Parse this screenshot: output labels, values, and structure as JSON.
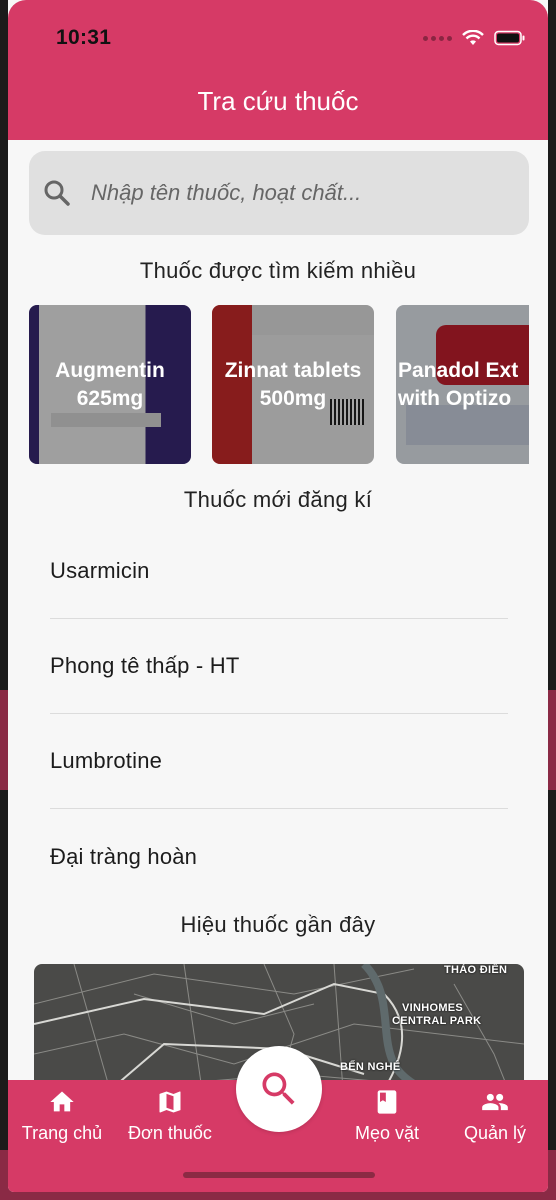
{
  "status_bar": {
    "time": "10:31"
  },
  "header": {
    "title": "Tra cứu thuốc"
  },
  "search": {
    "placeholder": "Nhập tên thuốc, hoạt chất..."
  },
  "popular": {
    "title": "Thuốc được tìm kiếm nhiều",
    "items": [
      {
        "line1": "Augmentin",
        "line2": "625mg"
      },
      {
        "line1": "Zinnat tablets",
        "line2": "500mg"
      },
      {
        "line1": "Panadol Ext",
        "line2": "with Optizo"
      }
    ]
  },
  "new_drugs": {
    "title": "Thuốc mới đăng kí",
    "items": [
      "Usarmicin",
      "Phong tê thấp - HT",
      "Lumbrotine",
      "Đại tràng hoàn"
    ]
  },
  "pharmacies": {
    "title": "Hiệu thuốc gần đây",
    "map_labels": [
      "THẢO ĐIỀN",
      "VINHOMES",
      "CENTRAL PARK",
      "BẾN NGHÉ"
    ]
  },
  "bottom_nav": {
    "items": [
      {
        "label": "Trang chủ",
        "icon": "home-icon"
      },
      {
        "label": "Đơn thuốc",
        "icon": "map-icon"
      },
      {
        "label": "Mẹo vặt",
        "icon": "book-icon"
      },
      {
        "label": "Quản lý",
        "icon": "people-icon"
      }
    ]
  },
  "colors": {
    "primary": "#d63a66",
    "background": "#f7f7f7",
    "search_bg": "#e0e0e0"
  }
}
